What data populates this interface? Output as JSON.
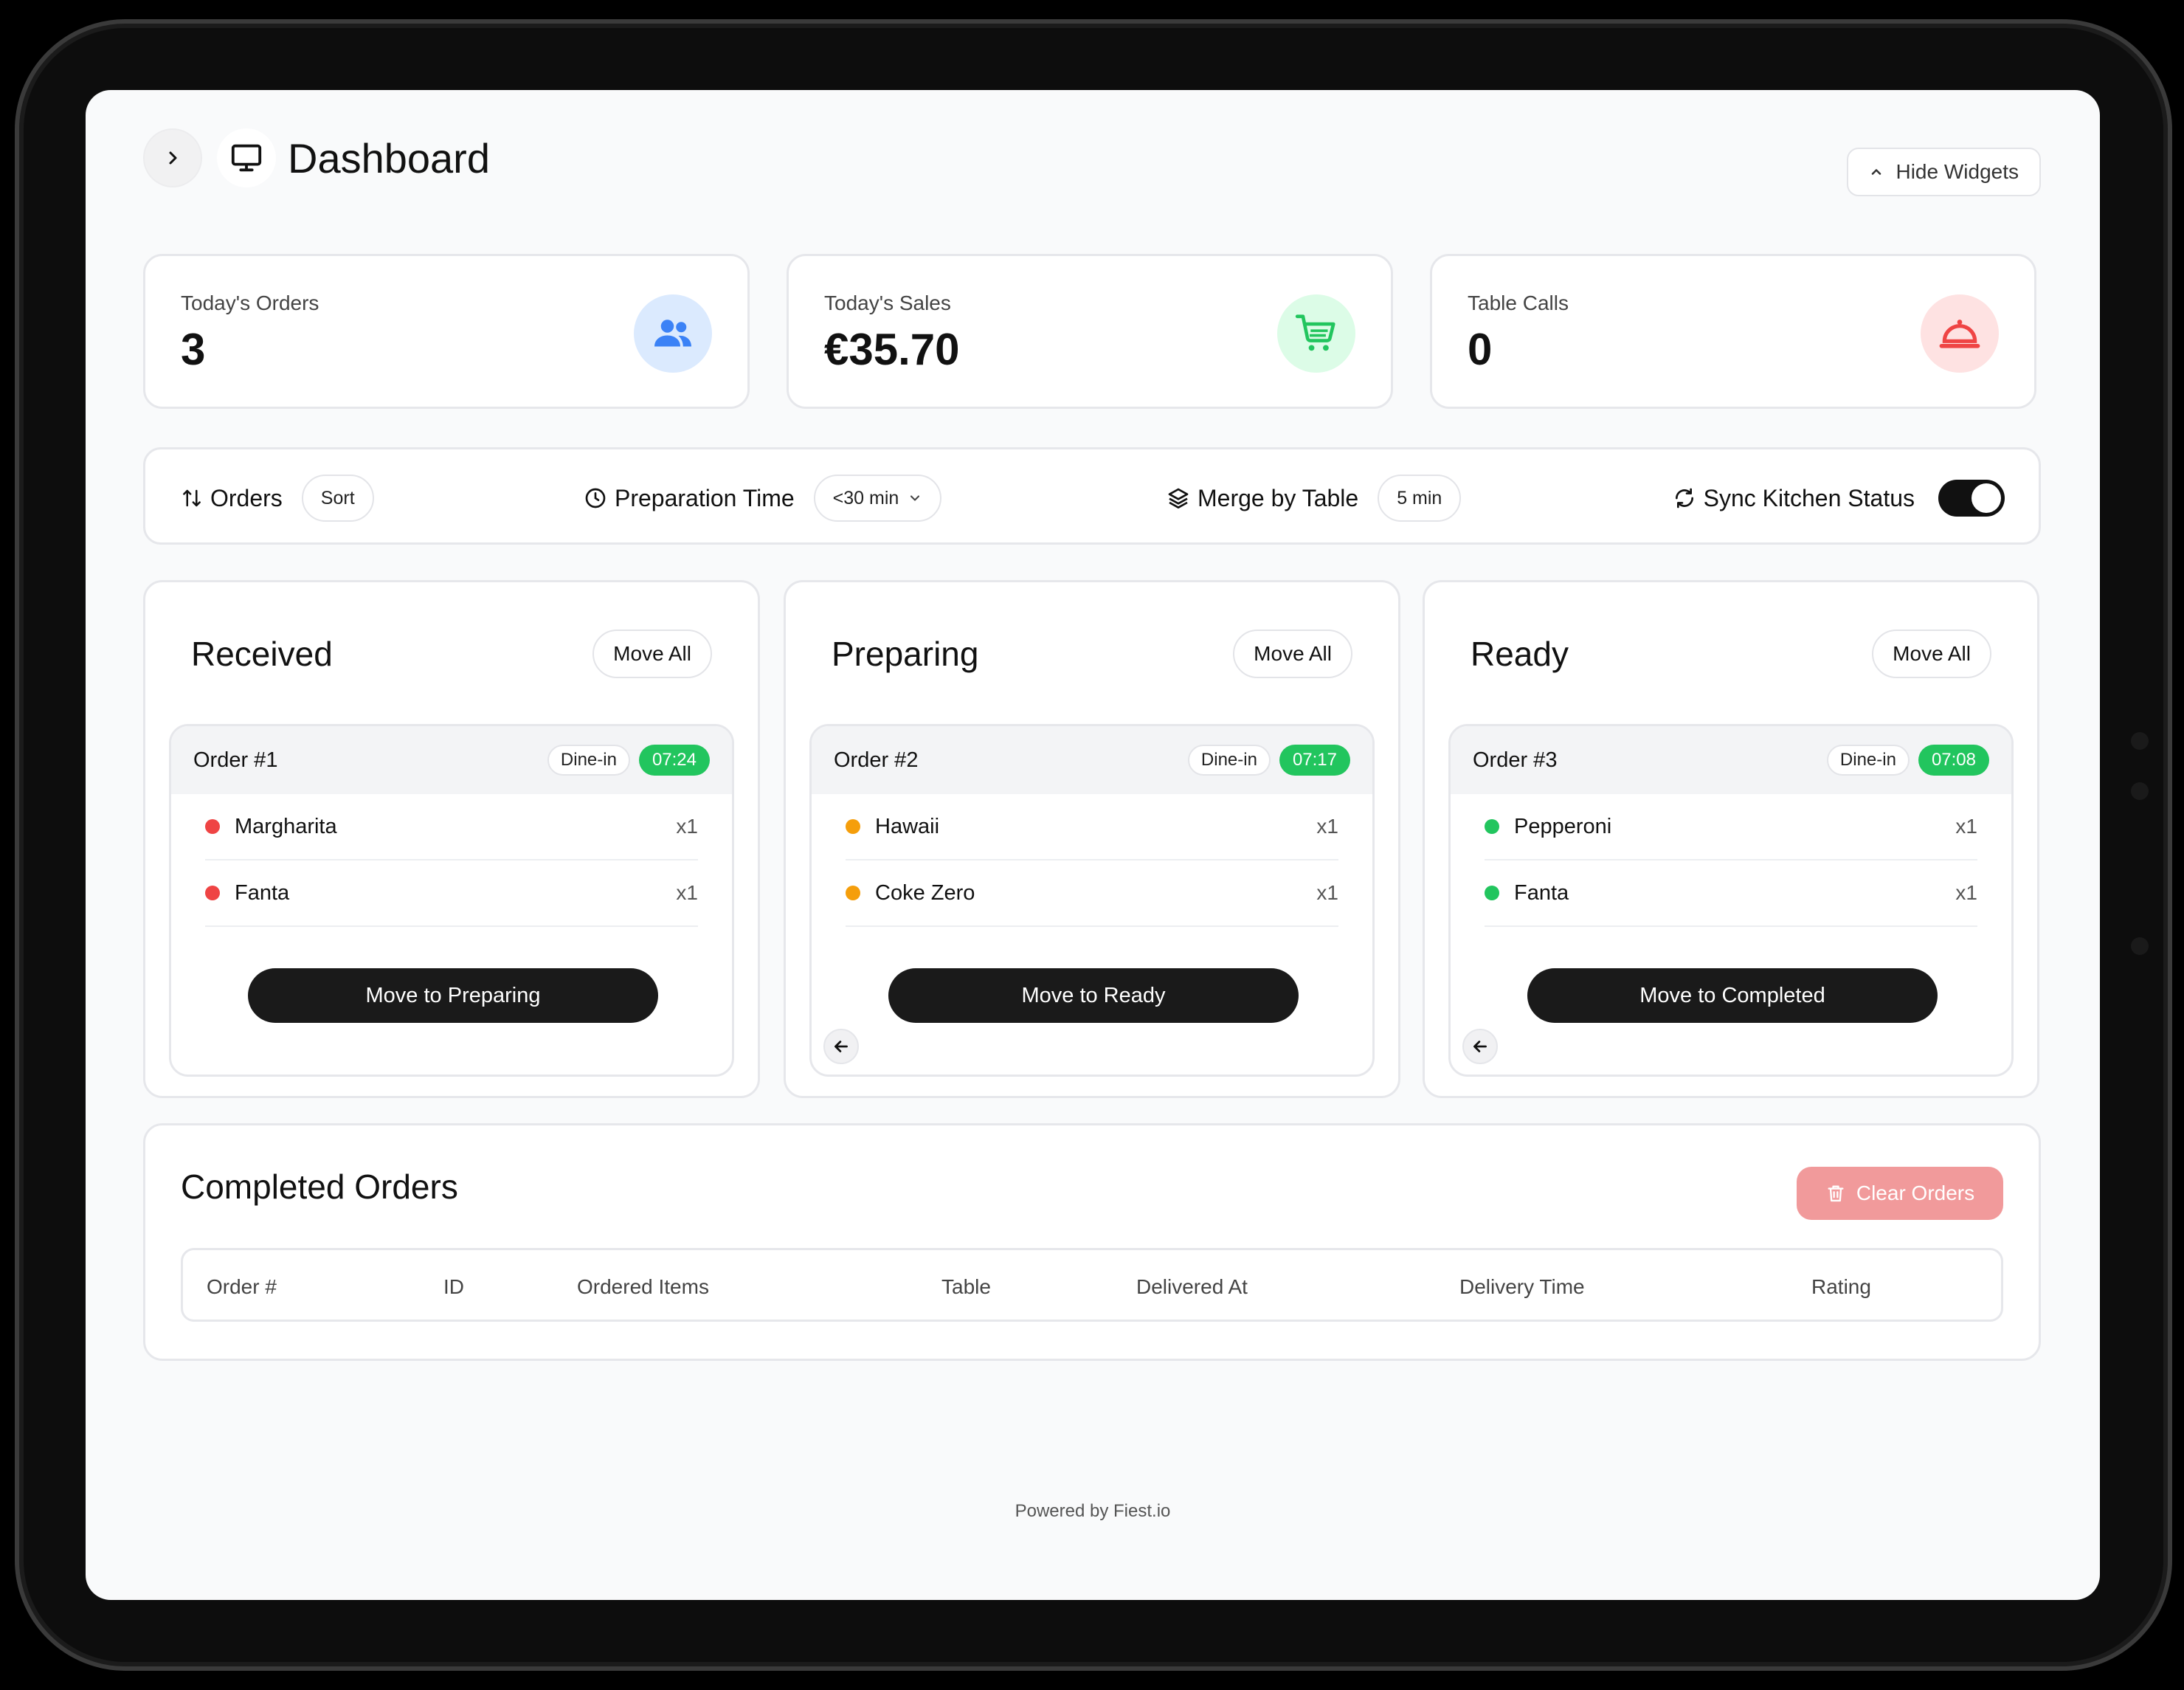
{
  "header": {
    "title": "Dashboard",
    "hide_widgets": "Hide Widgets"
  },
  "widgets": [
    {
      "label": "Today's Orders",
      "value": "3",
      "icon": "users-icon",
      "color": "#3b82f6",
      "bg": "#dbeafe"
    },
    {
      "label": "Today's Sales",
      "value": "€35.70",
      "icon": "cart-icon",
      "color": "#22c55e",
      "bg": "#dcfce7"
    },
    {
      "label": "Table Calls",
      "value": "0",
      "icon": "bell-icon",
      "color": "#ef4444",
      "bg": "#fee2e2"
    }
  ],
  "toolbar": {
    "orders_label": "Orders",
    "sort_label": "Sort",
    "prep_label": "Preparation Time",
    "prep_value": "<30 min",
    "merge_label": "Merge by Table",
    "merge_value": "5 min",
    "sync_label": "Sync Kitchen Status",
    "sync_on": true
  },
  "columns": [
    {
      "title": "Received",
      "move_all": "Move All",
      "order": {
        "number": "Order #1",
        "type": "Dine-in",
        "time": "07:24",
        "items": [
          {
            "name": "Margharita",
            "qty": "x1"
          },
          {
            "name": "Fanta",
            "qty": "x1"
          }
        ],
        "dot_color": "#ef4444",
        "action": "Move to Preparing"
      }
    },
    {
      "title": "Preparing",
      "move_all": "Move All",
      "order": {
        "number": "Order #2",
        "type": "Dine-in",
        "time": "07:17",
        "items": [
          {
            "name": "Hawaii",
            "qty": "x1"
          },
          {
            "name": "Coke Zero",
            "qty": "x1"
          }
        ],
        "dot_color": "#f59e0b",
        "action": "Move to Ready"
      }
    },
    {
      "title": "Ready",
      "move_all": "Move All",
      "order": {
        "number": "Order #3",
        "type": "Dine-in",
        "time": "07:08",
        "items": [
          {
            "name": "Pepperoni",
            "qty": "x1"
          },
          {
            "name": "Fanta",
            "qty": "x1"
          }
        ],
        "dot_color": "#22c55e",
        "action": "Move to Completed"
      }
    }
  ],
  "completed": {
    "title": "Completed Orders",
    "clear_label": "Clear Orders",
    "columns": [
      "Order #",
      "ID",
      "Ordered Items",
      "Table",
      "Delivered At",
      "Delivery Time",
      "Rating"
    ]
  },
  "footer": "Powered by Fiest.io",
  "colors": {
    "accent_dark": "#1a1a1a",
    "badge_green": "#22c55e",
    "danger_soft": "#f19a9b"
  }
}
